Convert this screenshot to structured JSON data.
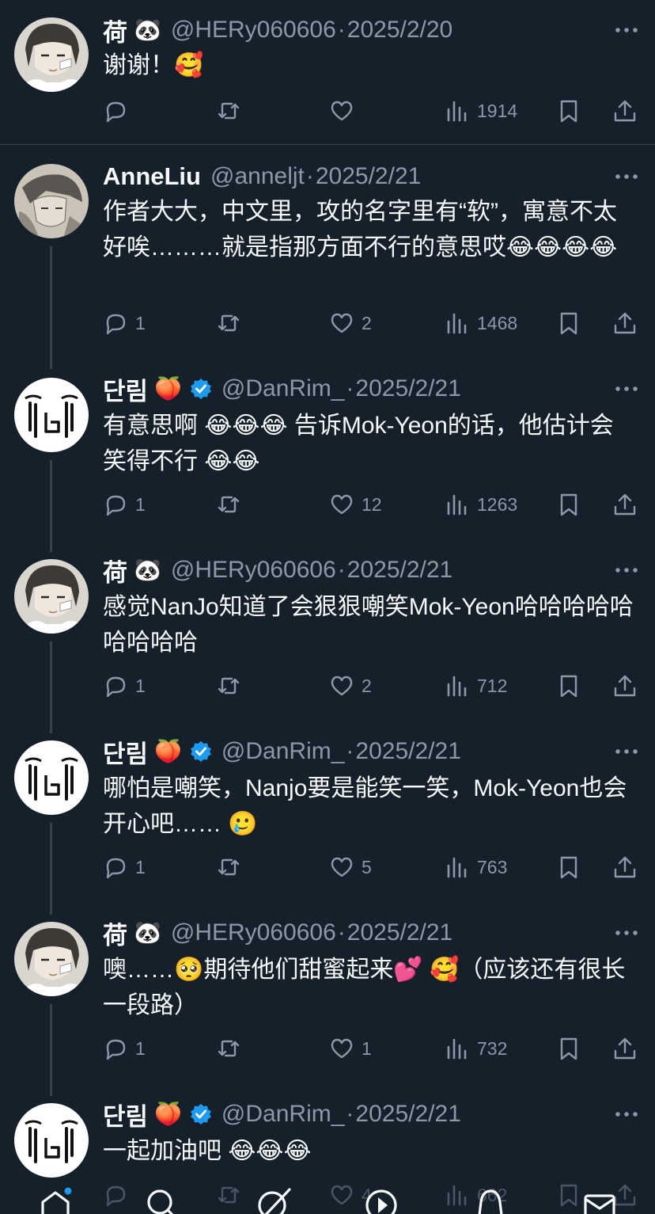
{
  "tweets": [
    {
      "name": "荷",
      "name_emoji": "🐼",
      "verified": false,
      "handle": "@HERy060606",
      "sep": "·",
      "date": "2025/2/20",
      "text": "谢谢！🥰",
      "reply_count": "",
      "retweet_count": "",
      "like_count": "",
      "views": "1914",
      "avatar": "man-avatar"
    },
    {
      "name": "AnneLiu",
      "name_emoji": "",
      "verified": false,
      "handle": "@anneljt",
      "sep": "·",
      "date": "2025/2/21",
      "text": "作者大大，中文里，攻的名字里有“软”，寓意不太好唉………就是指那方面不行的意思哎😂😂😂😂",
      "reply_count": "1",
      "retweet_count": "",
      "like_count": "2",
      "views": "1468",
      "avatar": "sketch-avatar"
    },
    {
      "name": "단림",
      "name_emoji": "🍑",
      "verified": true,
      "handle": "@DanRim_",
      "sep": "·",
      "date": "2025/2/21",
      "text": "有意思啊 😂😂😂 告诉Mok-Yeon的话，他估计会笑得不行 😂😂",
      "reply_count": "1",
      "retweet_count": "",
      "like_count": "12",
      "views": "1263",
      "avatar": "crying-avatar"
    },
    {
      "name": "荷",
      "name_emoji": "🐼",
      "verified": false,
      "handle": "@HERy060606",
      "sep": "·",
      "date": "2025/2/21",
      "text": "感觉NanJo知道了会狠狠嘲笑Mok-Yeon哈哈哈哈哈哈哈哈哈",
      "reply_count": "1",
      "retweet_count": "",
      "like_count": "2",
      "views": "712",
      "avatar": "man-avatar"
    },
    {
      "name": "단림",
      "name_emoji": "🍑",
      "verified": true,
      "handle": "@DanRim_",
      "sep": "·",
      "date": "2025/2/21",
      "text": "哪怕是嘲笑，Nanjo要是能笑一笑，Mok-Yeon也会开心吧…… 🥲",
      "reply_count": "1",
      "retweet_count": "",
      "like_count": "5",
      "views": "763",
      "avatar": "crying-avatar"
    },
    {
      "name": "荷",
      "name_emoji": "🐼",
      "verified": false,
      "handle": "@HERy060606",
      "sep": "·",
      "date": "2025/2/21",
      "text": "噢……🥺期待他们甜蜜起来💕 🥰（应该还有很长一段路）",
      "reply_count": "1",
      "retweet_count": "",
      "like_count": "1",
      "views": "732",
      "avatar": "man-avatar"
    },
    {
      "name": "단림",
      "name_emoji": "🍑",
      "verified": true,
      "handle": "@DanRim_",
      "sep": "·",
      "date": "2025/2/21",
      "text": "一起加油吧 😂😂😂",
      "reply_count": "",
      "retweet_count": "",
      "like_count": "4",
      "views": "662",
      "avatar": "crying-avatar"
    }
  ],
  "colors": {
    "background": "#15202b",
    "text": "#f7f9f9",
    "muted": "#8b98a5",
    "divider": "#38444d",
    "verified": "#1d9bf0"
  }
}
